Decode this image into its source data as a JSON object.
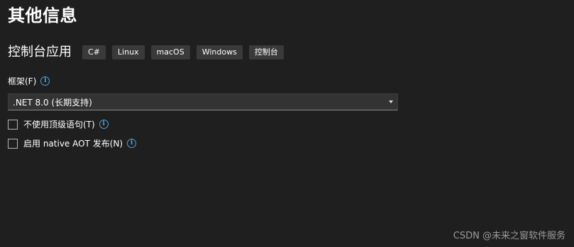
{
  "page": {
    "title": "其他信息"
  },
  "project": {
    "name": "控制台应用",
    "tags": [
      "C#",
      "Linux",
      "macOS",
      "Windows",
      "控制台"
    ]
  },
  "framework": {
    "label": "框架(F)",
    "selected": ".NET 8.0 (长期支持)"
  },
  "options": [
    {
      "label": "不使用顶级语句(T)",
      "checked": false
    },
    {
      "label": "启用 native AOT 发布(N)",
      "checked": false
    }
  ],
  "watermark": {
    "text": "CSDN @未来之窗软件服务"
  },
  "icons": {
    "info": "info-icon",
    "dropdown": "chevron-down-icon"
  },
  "colors": {
    "background": "#1f1f1f",
    "info_accent": "#4fa3d9",
    "tag_background": "#3a3a3a"
  }
}
